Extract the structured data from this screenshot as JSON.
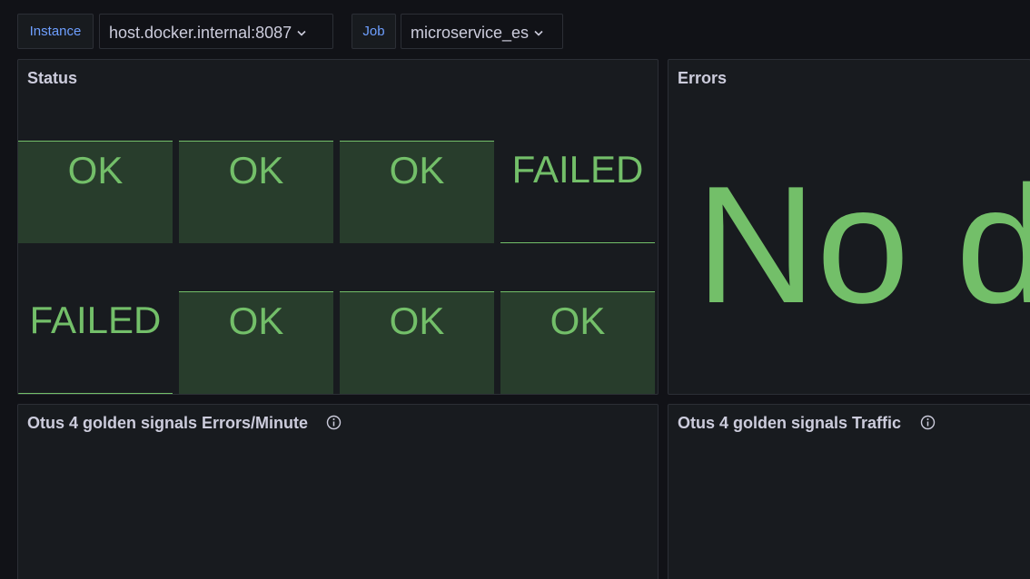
{
  "variables": {
    "instance": {
      "label": "Instance",
      "value": "host.docker.internal:8087"
    },
    "job": {
      "label": "Job",
      "value": "microservice_es"
    }
  },
  "status_panel": {
    "title": "Status",
    "cells": [
      "OK",
      "OK",
      "OK",
      "FAILED",
      "FAILED",
      "OK",
      "OK",
      "OK"
    ]
  },
  "errors_panel": {
    "title": "Errors",
    "message": "No d"
  },
  "errors_minute_panel": {
    "title": "Otus 4 golden signals Errors/Minute"
  },
  "traffic_panel": {
    "title": "Otus 4 golden signals Traffic"
  },
  "colors": {
    "accent_green": "#73bf69",
    "ok_fill": "#283d2c",
    "variable_label_blue": "#6e9fff",
    "panel_bg": "#181b1f",
    "page_bg": "#111217"
  },
  "icons": {
    "dropdown": "chevron-down-icon",
    "info": "info-icon"
  }
}
